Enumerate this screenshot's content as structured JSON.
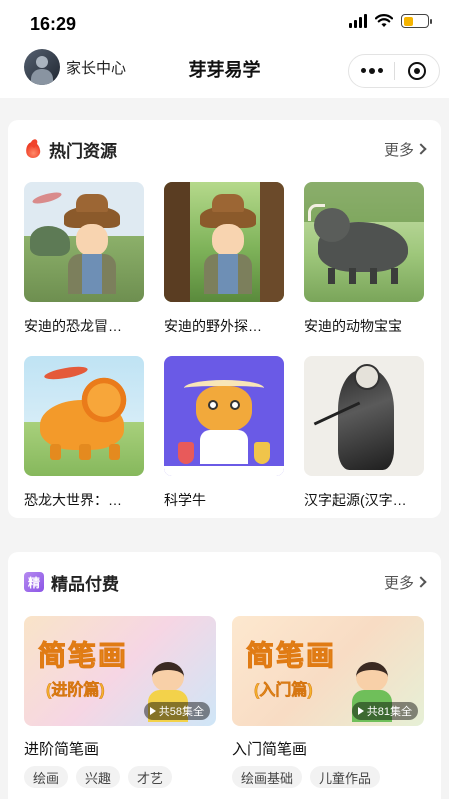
{
  "status_bar": {
    "time": "16:29"
  },
  "nav": {
    "parent_center": "家长中心",
    "title": "芽芽易学"
  },
  "hot": {
    "title": "热门资源",
    "more": "更多",
    "items": [
      {
        "title": "安迪的恐龙冒…",
        "image": "explorer-boy-dinosaur"
      },
      {
        "title": "安迪的野外探…",
        "image": "explorer-boy-forest"
      },
      {
        "title": "安迪的动物宝宝",
        "image": "wild-boar"
      },
      {
        "title": "恐龙大世界：…",
        "image": "triceratops"
      },
      {
        "title": "科学牛",
        "image": "science-cow"
      },
      {
        "title": "汉字起源(汉字…",
        "image": "ink-figure"
      }
    ]
  },
  "premium": {
    "title": "精品付费",
    "icon_text": "精",
    "more": "更多",
    "courses": [
      {
        "title": "进阶简笔画",
        "cover_title": "简笔画",
        "cover_sub": "(进阶篇)",
        "episodes": "共58集全",
        "tags": [
          "绘画",
          "兴趣",
          "才艺"
        ]
      },
      {
        "title": "入门简笔画",
        "cover_title": "简笔画",
        "cover_sub": "(入门篇)",
        "episodes": "共81集全",
        "tags": [
          "绘画基础",
          "儿童作品"
        ]
      }
    ]
  },
  "colors": {
    "flame": "#f0432b",
    "premium_icon": "#8b55e6",
    "cover_title": "#f4b32e"
  }
}
